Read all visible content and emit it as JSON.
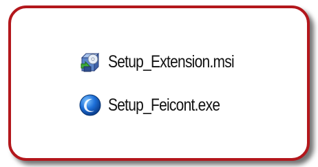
{
  "files": [
    {
      "name": "Setup_Extension.msi",
      "icon": "msi-installer-icon"
    },
    {
      "name": "Setup_Feicont.exe",
      "icon": "blue-sphere-app-icon"
    }
  ],
  "colors": {
    "frame_border": "#b3171c",
    "background": "#ffffff",
    "text": "#111111"
  }
}
